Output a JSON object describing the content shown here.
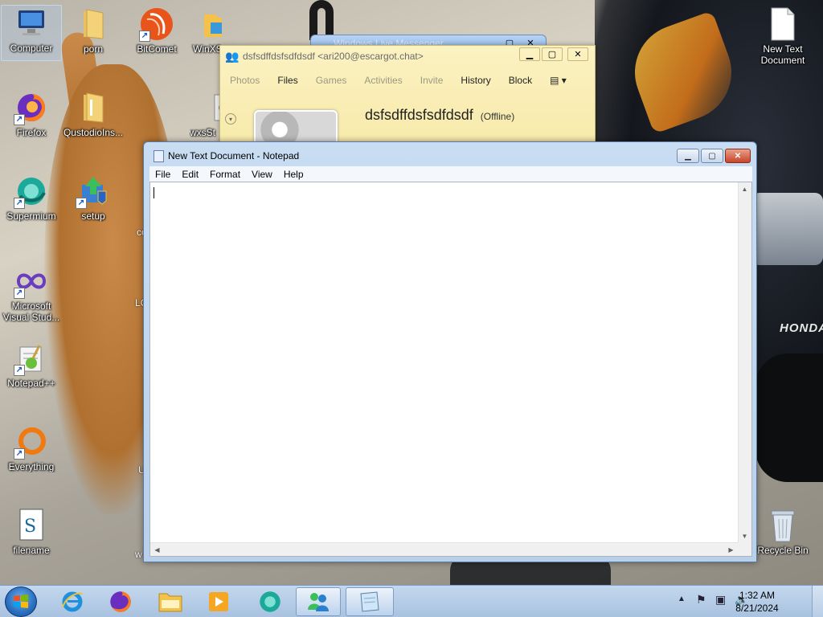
{
  "desktop": {
    "icons_left": [
      {
        "label": "Computer",
        "icon": "computer-icon"
      },
      {
        "label": "Firefox",
        "icon": "firefox-icon"
      },
      {
        "label": "Supermium",
        "icon": "supermium-icon"
      },
      {
        "label": "Microsoft Visual Stud...",
        "icon": "visual-studio-icon"
      },
      {
        "label": "Notepad++",
        "icon": "notepadpp-icon"
      },
      {
        "label": "Everything",
        "icon": "everything-icon"
      },
      {
        "label": "filename",
        "icon": "script-file-icon"
      }
    ],
    "icons_col2": [
      {
        "label": "porn",
        "icon": "folder-icon"
      },
      {
        "label": "QustodioIns...",
        "icon": "folder-icon"
      },
      {
        "label": "setup",
        "icon": "setup-icon"
      }
    ],
    "icons_col3": [
      {
        "label": "BitComet",
        "icon": "bitcomet-icon"
      }
    ],
    "icons_col4": [
      {
        "label": "WinXS",
        "icon": "winxs-folder-icon"
      },
      {
        "label": "wxsSt",
        "icon": "gear-icon"
      }
    ],
    "partial_labels": {
      "cc": "co",
      "lc": "LC",
      "u": "U",
      "w": "w"
    },
    "icons_right": [
      {
        "label": "New Text Document",
        "icon": "text-document-icon"
      },
      {
        "label": "Recycle Bin",
        "icon": "recycle-bin-icon"
      }
    ],
    "background_text": {
      "brand": "HONDA"
    }
  },
  "wlm_back": {
    "title": "Windows Live Messenger"
  },
  "wlm": {
    "title": "dsfsdffdsfsdfdsdf <ari200@escargot.chat>",
    "menu": [
      {
        "label": "Photos",
        "enabled": false
      },
      {
        "label": "Files",
        "enabled": true
      },
      {
        "label": "Games",
        "enabled": false
      },
      {
        "label": "Activities",
        "enabled": false
      },
      {
        "label": "Invite",
        "enabled": false
      },
      {
        "label": "History",
        "enabled": true
      },
      {
        "label": "Block",
        "enabled": true
      }
    ],
    "contact_name": "dsfsdffdsfsdfdsdf",
    "status": "(Offline)"
  },
  "notepad": {
    "title": "New Text Document - Notepad",
    "menu": [
      "File",
      "Edit",
      "Format",
      "View",
      "Help"
    ],
    "content": ""
  },
  "taskbar": {
    "pinned": [
      {
        "name": "internet-explorer-icon"
      },
      {
        "name": "firefox-icon"
      },
      {
        "name": "file-explorer-icon"
      },
      {
        "name": "media-player-icon"
      },
      {
        "name": "supermium-icon"
      },
      {
        "name": "windows-live-messenger-icon"
      },
      {
        "name": "notepad-icon"
      }
    ],
    "tray": {
      "show_hidden": "▲",
      "flag": "⚑",
      "network": "▣",
      "volume": "🔈"
    },
    "clock": {
      "time": "1:32 AM",
      "date": "8/21/2024"
    }
  }
}
